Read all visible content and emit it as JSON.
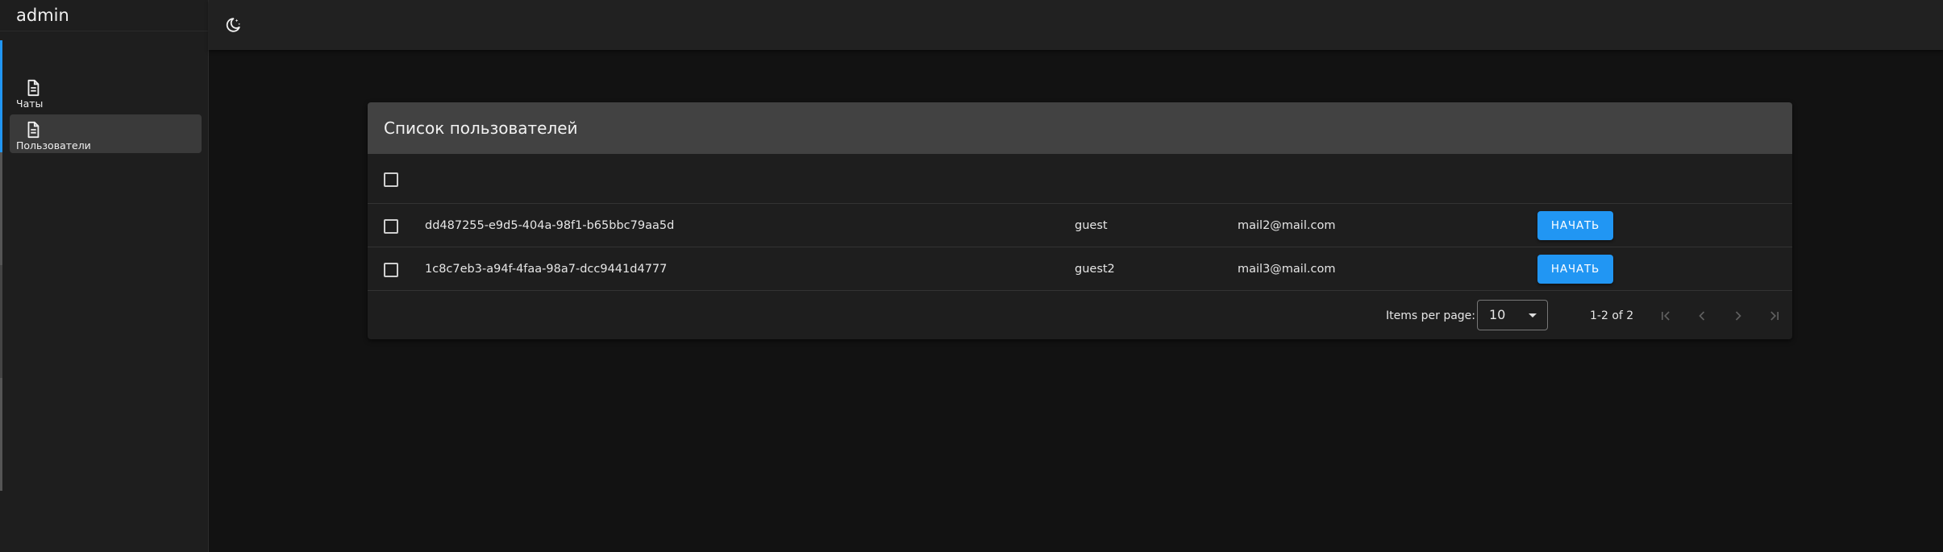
{
  "sidebar": {
    "brand": "admin",
    "items": [
      {
        "label": "Чаты",
        "icon": "document-icon",
        "active": false
      },
      {
        "label": "Пользователи",
        "icon": "document-icon",
        "active": true
      }
    ]
  },
  "topbar": {
    "theme_icon": "moon-icon"
  },
  "table": {
    "title": "Список пользователей",
    "rows": [
      {
        "id": "dd487255-e9d5-404a-98f1-b65bbc79aa5d",
        "name": "guest",
        "email": "mail2@mail.com",
        "action": "НАЧАТЬ"
      },
      {
        "id": "1c8c7eb3-a94f-4faa-98a7-dcc9441d4777",
        "name": "guest2",
        "email": "mail3@mail.com",
        "action": "НАЧАТЬ"
      }
    ]
  },
  "paginator": {
    "items_per_page_label": "Items per page:",
    "page_size": "10",
    "range_label": "1-2 of 2"
  },
  "colors": {
    "accent": "#2196f3",
    "background": "#121212",
    "surface": "#1e1e1e",
    "header": "#424242"
  }
}
